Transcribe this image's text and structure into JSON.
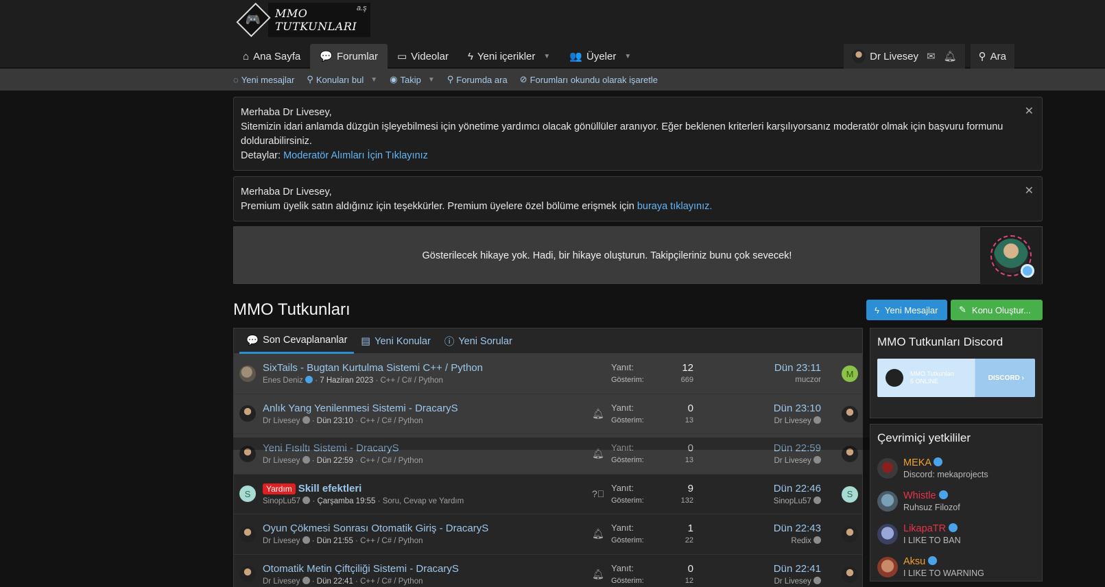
{
  "logo": {
    "text": "MMO TUTKUNLARI",
    "sub": "a.ş"
  },
  "nav": [
    {
      "label": "Ana Sayfa",
      "icon": "home-icon",
      "active": false,
      "caret": false
    },
    {
      "label": "Forumlar",
      "icon": "comments-icon",
      "active": true,
      "caret": false
    },
    {
      "label": "Videolar",
      "icon": "video-icon",
      "active": false,
      "caret": false
    },
    {
      "label": "Yeni içerikler",
      "icon": "bolt-icon",
      "active": false,
      "caret": true
    },
    {
      "label": "Üyeler",
      "icon": "users-icon",
      "active": false,
      "caret": true
    }
  ],
  "account": {
    "username": "Dr Livesey",
    "search_label": "Ara"
  },
  "subnav": [
    {
      "label": "Yeni mesajlar",
      "caret": false
    },
    {
      "label": "Konuları bul",
      "caret": true
    },
    {
      "label": "Takip",
      "caret": true
    },
    {
      "label": "Forumda ara",
      "caret": false
    },
    {
      "label": "Forumları okundu olarak işaretle",
      "caret": false
    }
  ],
  "notice1": {
    "greeting": "Merhaba Dr Livesey,",
    "body": "Sitemizin idari anlamda düzgün işleyebilmesi için yönetime yardımcı olacak gönüllüler aranıyor. Eğer beklenen kriterleri karşılıyorsanız moderatör olmak için başvuru formunu doldurabilirsiniz.",
    "details_label": "Detaylar:",
    "details_link": "Moderatör Alımları İçin Tıklayınız"
  },
  "notice2": {
    "greeting": "Merhaba Dr Livesey,",
    "body": "Premium üyelik satın aldığınız için teşekkürler. Premium üyelere özel bölüme erişmek için",
    "link": "buraya tıklayınız."
  },
  "story": {
    "text": "Gösterilecek hikaye yok. Hadi, bir hikaye oluşturun. Takipçileriniz bunu çok sevecek!"
  },
  "page": {
    "title": "MMO Tutkunları",
    "btn_new_posts": "Yeni Mesajlar",
    "btn_new_thread": "Konu Oluştur..."
  },
  "tabs": [
    "Son Cevaplananlar",
    "Yeni Konular",
    "Yeni Sorular"
  ],
  "stat_labels": {
    "replies": "Yanıt:",
    "views": "Gösterim:"
  },
  "threads": [
    {
      "label": "",
      "title": "SixTails - Bugtan Kurtulma Sistemi C++ / Python",
      "author": "Enes Deniz",
      "date": "7 Haziran 2023",
      "forum": "C++ / C# / Python",
      "replies": "12",
      "views": "669",
      "last_date": "Dün 23:11",
      "last_user": "muczor",
      "icon": "",
      "avatar": "cat",
      "last_avatar": "M"
    },
    {
      "label": "",
      "title": "Anlık Yang Yenilenmesi Sistemi - DracaryS",
      "author": "Dr Livesey",
      "date": "Dün 23:10",
      "forum": "C++ / C# / Python",
      "replies": "0",
      "views": "13",
      "last_date": "Dün 23:10",
      "last_user": "Dr Livesey",
      "icon": "bell",
      "avatar": "face",
      "last_avatar": "face"
    },
    {
      "label": "",
      "title": "Yeni Fısıltı Sistemi - DracaryS",
      "author": "Dr Livesey",
      "date": "Dün 22:59",
      "forum": "C++ / C# / Python",
      "replies": "0",
      "views": "13",
      "last_date": "Dün 22:59",
      "last_user": "Dr Livesey",
      "icon": "bell",
      "avatar": "face",
      "last_avatar": "face"
    },
    {
      "label": "Yardım",
      "title": "Skill efektleri",
      "author": "SinopLu57",
      "date": "Çarşamba 19:55",
      "forum": "Soru, Cevap ve Yardım",
      "replies": "9",
      "views": "132",
      "last_date": "Dün 22:46",
      "last_user": "SinopLu57",
      "icon": "question",
      "avatar": "S",
      "last_avatar": "S"
    },
    {
      "label": "",
      "title": "Oyun Çökmesi Sonrası Otomatik Giriş - DracaryS",
      "author": "Dr Livesey",
      "date": "Dün 21:55",
      "forum": "C++ / C# / Python",
      "replies": "1",
      "views": "22",
      "last_date": "Dün 22:43",
      "last_user": "Redix",
      "icon": "bell",
      "avatar": "face",
      "last_avatar": "face"
    },
    {
      "label": "",
      "title": "Otomatik Metin Çiftçiliği Sistemi - DracaryS",
      "author": "Dr Livesey",
      "date": "Dün 22:41",
      "forum": "C++ / C# / Python",
      "replies": "0",
      "views": "12",
      "last_date": "Dün 22:41",
      "last_user": "Dr Livesey",
      "icon": "bell",
      "avatar": "face",
      "last_avatar": "face"
    }
  ],
  "discord": {
    "title": "MMO Tutkunları Discord",
    "banner_name": "MMO Tutkunları",
    "banner_status": "5 ONLINE",
    "banner_word": "DISCORD"
  },
  "staff": {
    "title": "Çevrimiçi yetkililer",
    "members": [
      {
        "name": "MEKA",
        "sub": "Discord: mekaprojects",
        "color": "#f0a030"
      },
      {
        "name": "Whistle",
        "sub": "Ruhsuz Filozof",
        "color": "#e8334a"
      },
      {
        "name": "LikapaTR",
        "sub": "I LIKE TO BAN",
        "color": "#e8334a"
      },
      {
        "name": "Aksu",
        "sub": "I LIKE TO WARNING",
        "color": "#f0a030"
      }
    ]
  },
  "colors": {
    "accent_blue": "#2c8fd6",
    "accent_green": "#47b04b",
    "link": "#9cc7eb",
    "label_red": "#e02020"
  }
}
